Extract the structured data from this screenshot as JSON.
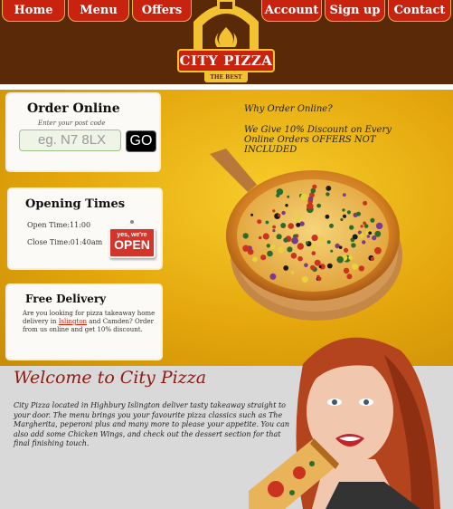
{
  "nav": {
    "home": "Home",
    "menu": "Menu",
    "offers": "Offers",
    "account": "Account",
    "signup": "Sign up",
    "contact": "Contact"
  },
  "logo": {
    "name": "CITY PIZZA",
    "tagline": "THE BEST"
  },
  "order": {
    "title": "Order Online",
    "hint": "Enter your post code",
    "placeholder": "eg. N7 8LX",
    "go": "GO"
  },
  "hours": {
    "title": "Opening Times",
    "open": "Open Time:11:00",
    "close": "Close Time:01:40am",
    "sign_small": "yes, we're",
    "sign_big": "OPEN"
  },
  "delivery": {
    "title": "Free Delivery",
    "text_before": "Are you looking for pizza takeaway home delivery in ",
    "link": "Islington",
    "text_after": " and Camden? Order from us online and get 10% discount."
  },
  "promo": {
    "why": "Why Order Online?",
    "offer": "We Give 10% Discount on Every Online Orders OFFERS NOT INCLUDED"
  },
  "welcome": {
    "title": "Welcome to City Pizza",
    "text": "City Pizza located in Highbury Islington deliver tasty takeaway straight to your door. The menu brings you your favourite pizza classics such as The Margherita, peperoni plus and many more to please your appetite. You can also add some Chicken Wings, and check out the dessert section for that final finishing touch."
  },
  "colors": {
    "brand_red": "#c8230f",
    "header_brown": "#5a2a08",
    "accent_yellow": "#f2c230"
  }
}
